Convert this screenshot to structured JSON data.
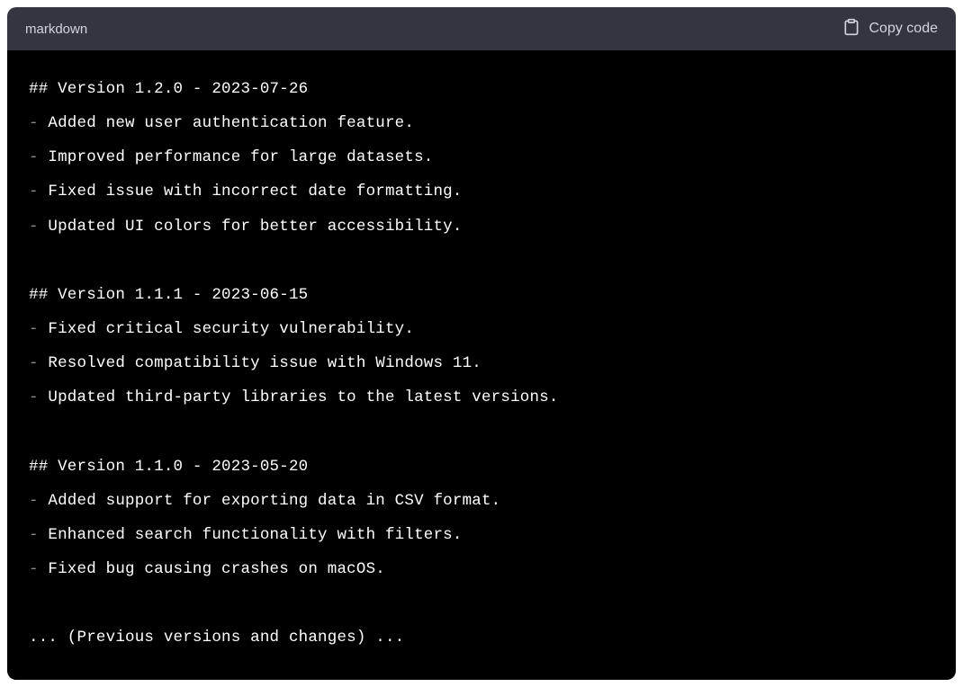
{
  "header": {
    "language": "markdown",
    "copy_label": "Copy code"
  },
  "code": {
    "b0_heading": "## Version 1.2.0 - 2023-07-26",
    "b0_l0": "Added new user authentication feature.",
    "b0_l1": "Improved performance for large datasets.",
    "b0_l2": "Fixed issue with incorrect date formatting.",
    "b0_l3": "Updated UI colors for better accessibility.",
    "b1_heading": "## Version 1.1.1 - 2023-06-15",
    "b1_l0": "Fixed critical security vulnerability.",
    "b1_l1": "Resolved compatibility issue with Windows 11.",
    "b1_l2": "Updated third-party libraries to the latest versions.",
    "b2_heading": "## Version 1.1.0 - 2023-05-20",
    "b2_l0": "Added support for exporting data in CSV format.",
    "b2_l1": "Enhanced search functionality with filters.",
    "b2_l2": "Fixed bug causing crashes on macOS.",
    "trailing": "... (Previous versions and changes) ..."
  }
}
